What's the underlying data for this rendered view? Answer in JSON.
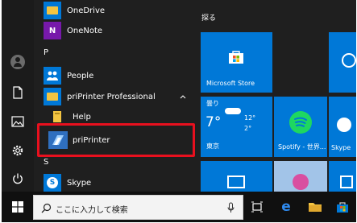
{
  "apps": {
    "onedrive": "OneDrive",
    "onenote": "OneNote",
    "letter_p": "P",
    "people": "People",
    "pri_folder": "priPrinter Professional",
    "help": "Help",
    "priprinter": "priPrinter",
    "letter_s": "S",
    "skype": "Skype"
  },
  "tiles": {
    "group_title": "探る",
    "store": "Microsoft Store",
    "weather_condition": "曇り",
    "weather_temp": "7°",
    "weather_high": "12°",
    "weather_low": "2°",
    "weather_city": "東京",
    "spotify": "Spotify - 世界...",
    "skype": "Skype"
  },
  "taskbar": {
    "search_placeholder": "ここに入力して検索"
  },
  "colors": {
    "tile_blue": "#0078d7",
    "onenote_purple": "#7719aa",
    "spotify_green": "#1ed760",
    "highlight_red": "#e8101e"
  }
}
